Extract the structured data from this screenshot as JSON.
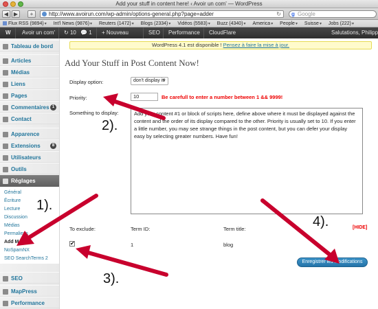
{
  "browser": {
    "window_title": "Add your stuff in content here! ‹ Avoir un com' — WordPress",
    "url": "http://www.avoirun.com/wp-admin/options-general.php?page=adder",
    "search_placeholder": "Google",
    "nav_buttons": [
      "◀",
      "▶",
      "+"
    ],
    "bookmarks": [
      {
        "label": "Flux RSS (9894)",
        "menu": true
      },
      {
        "label": "Int'l News (9876)",
        "menu": true
      },
      {
        "label": "Reuters (1472)",
        "menu": true
      },
      {
        "label": "Blogs (2334)",
        "menu": true
      },
      {
        "label": "Vidéos (5583)",
        "menu": true
      },
      {
        "label": "Buzz (4340)",
        "menu": true
      },
      {
        "label": "America",
        "menu": true
      },
      {
        "label": "People",
        "menu": true
      },
      {
        "label": "Suisse",
        "menu": true
      },
      {
        "label": "Jobs (222)",
        "menu": true
      }
    ]
  },
  "adminbar": {
    "wp_logo": "W",
    "site_name": "Avoir un com'",
    "updates": "10",
    "comments": "1",
    "new_label": "+ Nouveau",
    "items": [
      "SEO",
      "Performance",
      "CloudFlare"
    ],
    "greeting": "Salutations, Philipp"
  },
  "sidebar": {
    "items": [
      {
        "label": "Tableau de bord",
        "icon": "dashboard-icon"
      },
      {
        "label": "Articles",
        "icon": "pin-icon"
      },
      {
        "label": "Médias",
        "icon": "media-icon"
      },
      {
        "label": "Liens",
        "icon": "link-icon"
      },
      {
        "label": "Pages",
        "icon": "page-icon"
      },
      {
        "label": "Commentaires",
        "icon": "comment-icon",
        "count": "1"
      },
      {
        "label": "Contact",
        "icon": "mail-icon"
      },
      {
        "label": "Apparence",
        "icon": "brush-icon"
      },
      {
        "label": "Extensions",
        "icon": "plugin-icon",
        "count": "8"
      },
      {
        "label": "Utilisateurs",
        "icon": "users-icon"
      },
      {
        "label": "Outils",
        "icon": "tools-icon"
      },
      {
        "label": "Réglages",
        "icon": "settings-icon"
      }
    ],
    "settings_submenu": [
      "Général",
      "Écriture",
      "Lecture",
      "Discussion",
      "Médias",
      "Permaliens",
      "Add Me",
      "NoSpamNX",
      "SEO SearchTerms 2"
    ],
    "bottom_items": [
      {
        "label": "SEO",
        "icon": "seo-icon"
      },
      {
        "label": "MapPress",
        "icon": "map-icon"
      },
      {
        "label": "Performance",
        "icon": "performance-icon"
      }
    ]
  },
  "notice": {
    "text": "WordPress 4.1 est disponible ! ",
    "link": "Pensez à faire la mise à jour."
  },
  "page": {
    "title": "Add Your Stuff in Post Content Now!",
    "display_option_label": "Display option:",
    "display_option_value": "don't display it!",
    "priority_label": "Priority:",
    "priority_value": "10",
    "priority_warning": "Be carefull to enter a number between 1 && 9999!",
    "something_label": "Something to display:",
    "something_value": "Add your content #1 or block of scripts here, define above where it must be displayed against the content and the order of its display compared to the other. Priority is usually set to 10. If you enter a little number, you may see strange things in the post content, but you can defer your display easy by selecting greater numbers. Have fun!",
    "exclude_label": "To exclude:",
    "term_id_label": "Term ID:",
    "term_title_label": "Term title:",
    "hide_link": "[HIDE]",
    "term_id_value": "1",
    "term_title_value": "blog",
    "checkbox_mark": "✔",
    "save_button": "Enregistrer les modifications"
  },
  "annotations": [
    "1).",
    "2).",
    "3).",
    "4)."
  ],
  "colors": {
    "arrow": "#c8002d",
    "link": "#21759b",
    "admin_bar": "#3a3a3a",
    "warning": "#ee0000",
    "button": "#2e83bb"
  }
}
